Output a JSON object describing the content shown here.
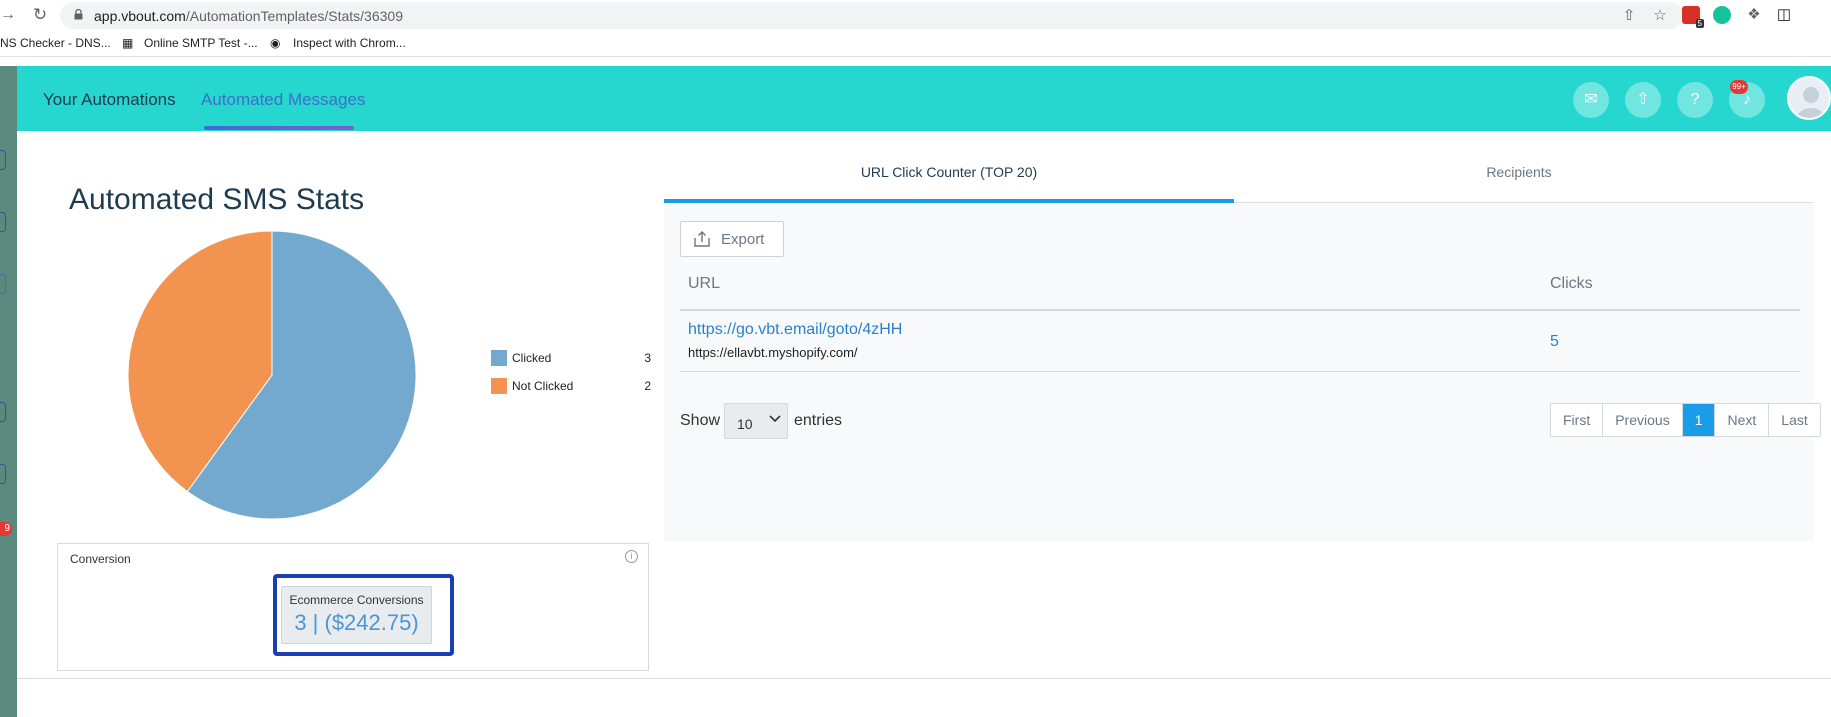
{
  "browser": {
    "url_host": "app.vbout.com",
    "url_path": "/AutomationTemplates/Stats/36309",
    "extension_badge": "5",
    "bookmarks": [
      {
        "label": "NS Checker - DNS..."
      },
      {
        "label": "Online SMTP Test -..."
      },
      {
        "label": "Inspect with Chrom..."
      }
    ]
  },
  "sidebar": {
    "badge": "9"
  },
  "header": {
    "tabs": [
      {
        "label": "Your Automations"
      },
      {
        "label": "Automated Messages"
      }
    ],
    "notifications_badge": "99+"
  },
  "main": {
    "title": "Automated SMS Stats",
    "legend": [
      {
        "label": "Clicked",
        "value": "3",
        "color": "#73a9cf"
      },
      {
        "label": "Not Clicked",
        "value": "2",
        "color": "#f29450"
      }
    ],
    "conversion": {
      "title": "Conversion",
      "info": "i",
      "label": "Ecommerce Conversions",
      "value": "3 | ($242.75)"
    }
  },
  "chart_data": {
    "type": "pie",
    "categories": [
      "Clicked",
      "Not Clicked"
    ],
    "values": [
      3,
      2
    ],
    "colors": [
      "#73a9cf",
      "#f29450"
    ],
    "legend": "right"
  },
  "right_panel": {
    "tabs": [
      {
        "label": "URL Click Counter (TOP 20)"
      },
      {
        "label": "Recipients"
      }
    ],
    "export_label": "Export",
    "columns": [
      "URL",
      "Clicks"
    ],
    "rows": [
      {
        "url": "https://go.vbt.email/goto/4zHH",
        "destination": "https://ellavbt.myshopify.com/",
        "clicks": "5"
      }
    ],
    "show_label": "Show",
    "page_size": "10",
    "entries_label": "entries",
    "pagination": [
      "First",
      "Previous",
      "1",
      "Next",
      "Last"
    ]
  }
}
